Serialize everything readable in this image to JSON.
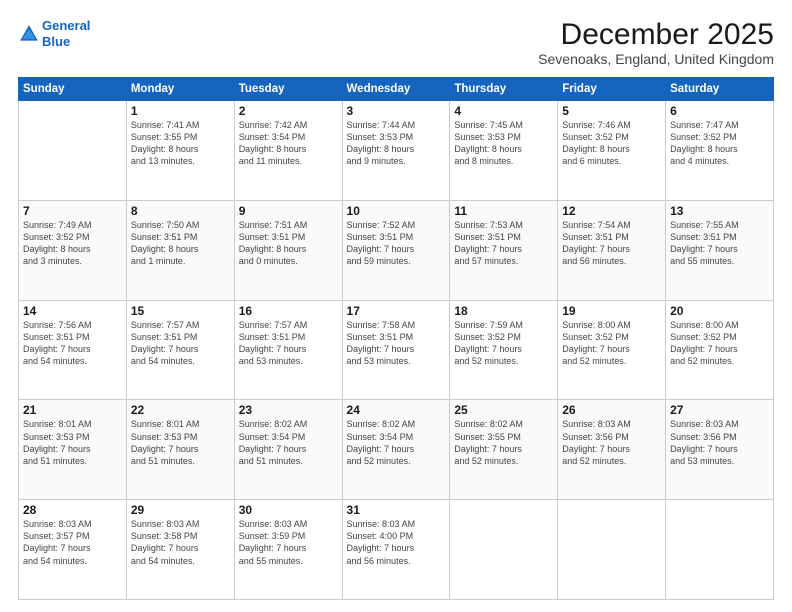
{
  "logo": {
    "line1": "General",
    "line2": "Blue"
  },
  "title": "December 2025",
  "location": "Sevenoaks, England, United Kingdom",
  "weekdays": [
    "Sunday",
    "Monday",
    "Tuesday",
    "Wednesday",
    "Thursday",
    "Friday",
    "Saturday"
  ],
  "weeks": [
    [
      {
        "day": "",
        "info": ""
      },
      {
        "day": "1",
        "info": "Sunrise: 7:41 AM\nSunset: 3:55 PM\nDaylight: 8 hours\nand 13 minutes."
      },
      {
        "day": "2",
        "info": "Sunrise: 7:42 AM\nSunset: 3:54 PM\nDaylight: 8 hours\nand 11 minutes."
      },
      {
        "day": "3",
        "info": "Sunrise: 7:44 AM\nSunset: 3:53 PM\nDaylight: 8 hours\nand 9 minutes."
      },
      {
        "day": "4",
        "info": "Sunrise: 7:45 AM\nSunset: 3:53 PM\nDaylight: 8 hours\nand 8 minutes."
      },
      {
        "day": "5",
        "info": "Sunrise: 7:46 AM\nSunset: 3:52 PM\nDaylight: 8 hours\nand 6 minutes."
      },
      {
        "day": "6",
        "info": "Sunrise: 7:47 AM\nSunset: 3:52 PM\nDaylight: 8 hours\nand 4 minutes."
      }
    ],
    [
      {
        "day": "7",
        "info": "Sunrise: 7:49 AM\nSunset: 3:52 PM\nDaylight: 8 hours\nand 3 minutes."
      },
      {
        "day": "8",
        "info": "Sunrise: 7:50 AM\nSunset: 3:51 PM\nDaylight: 8 hours\nand 1 minute."
      },
      {
        "day": "9",
        "info": "Sunrise: 7:51 AM\nSunset: 3:51 PM\nDaylight: 8 hours\nand 0 minutes."
      },
      {
        "day": "10",
        "info": "Sunrise: 7:52 AM\nSunset: 3:51 PM\nDaylight: 7 hours\nand 59 minutes."
      },
      {
        "day": "11",
        "info": "Sunrise: 7:53 AM\nSunset: 3:51 PM\nDaylight: 7 hours\nand 57 minutes."
      },
      {
        "day": "12",
        "info": "Sunrise: 7:54 AM\nSunset: 3:51 PM\nDaylight: 7 hours\nand 56 minutes."
      },
      {
        "day": "13",
        "info": "Sunrise: 7:55 AM\nSunset: 3:51 PM\nDaylight: 7 hours\nand 55 minutes."
      }
    ],
    [
      {
        "day": "14",
        "info": "Sunrise: 7:56 AM\nSunset: 3:51 PM\nDaylight: 7 hours\nand 54 minutes."
      },
      {
        "day": "15",
        "info": "Sunrise: 7:57 AM\nSunset: 3:51 PM\nDaylight: 7 hours\nand 54 minutes."
      },
      {
        "day": "16",
        "info": "Sunrise: 7:57 AM\nSunset: 3:51 PM\nDaylight: 7 hours\nand 53 minutes."
      },
      {
        "day": "17",
        "info": "Sunrise: 7:58 AM\nSunset: 3:51 PM\nDaylight: 7 hours\nand 53 minutes."
      },
      {
        "day": "18",
        "info": "Sunrise: 7:59 AM\nSunset: 3:52 PM\nDaylight: 7 hours\nand 52 minutes."
      },
      {
        "day": "19",
        "info": "Sunrise: 8:00 AM\nSunset: 3:52 PM\nDaylight: 7 hours\nand 52 minutes."
      },
      {
        "day": "20",
        "info": "Sunrise: 8:00 AM\nSunset: 3:52 PM\nDaylight: 7 hours\nand 52 minutes."
      }
    ],
    [
      {
        "day": "21",
        "info": "Sunrise: 8:01 AM\nSunset: 3:53 PM\nDaylight: 7 hours\nand 51 minutes."
      },
      {
        "day": "22",
        "info": "Sunrise: 8:01 AM\nSunset: 3:53 PM\nDaylight: 7 hours\nand 51 minutes."
      },
      {
        "day": "23",
        "info": "Sunrise: 8:02 AM\nSunset: 3:54 PM\nDaylight: 7 hours\nand 51 minutes."
      },
      {
        "day": "24",
        "info": "Sunrise: 8:02 AM\nSunset: 3:54 PM\nDaylight: 7 hours\nand 52 minutes."
      },
      {
        "day": "25",
        "info": "Sunrise: 8:02 AM\nSunset: 3:55 PM\nDaylight: 7 hours\nand 52 minutes."
      },
      {
        "day": "26",
        "info": "Sunrise: 8:03 AM\nSunset: 3:56 PM\nDaylight: 7 hours\nand 52 minutes."
      },
      {
        "day": "27",
        "info": "Sunrise: 8:03 AM\nSunset: 3:56 PM\nDaylight: 7 hours\nand 53 minutes."
      }
    ],
    [
      {
        "day": "28",
        "info": "Sunrise: 8:03 AM\nSunset: 3:57 PM\nDaylight: 7 hours\nand 54 minutes."
      },
      {
        "day": "29",
        "info": "Sunrise: 8:03 AM\nSunset: 3:58 PM\nDaylight: 7 hours\nand 54 minutes."
      },
      {
        "day": "30",
        "info": "Sunrise: 8:03 AM\nSunset: 3:59 PM\nDaylight: 7 hours\nand 55 minutes."
      },
      {
        "day": "31",
        "info": "Sunrise: 8:03 AM\nSunset: 4:00 PM\nDaylight: 7 hours\nand 56 minutes."
      },
      {
        "day": "",
        "info": ""
      },
      {
        "day": "",
        "info": ""
      },
      {
        "day": "",
        "info": ""
      }
    ]
  ]
}
